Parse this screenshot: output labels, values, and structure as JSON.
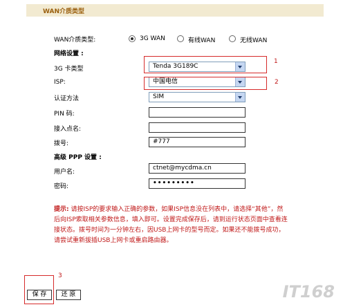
{
  "header": {
    "title": "WAN介质类型"
  },
  "wan_type": {
    "label": "WAN介质类型:",
    "options": [
      {
        "label": "3G WAN",
        "selected": true
      },
      {
        "label": "有线WAN",
        "selected": false
      },
      {
        "label": "无线WAN",
        "selected": false
      }
    ]
  },
  "network_settings": {
    "heading": "网络设置 :",
    "card_type_label": "3G 卡类型",
    "card_type_value": "Tenda 3G189C",
    "isp_label": "ISP:",
    "isp_value": "中国电信",
    "auth_label": "认证方法",
    "auth_value": "SIM",
    "pin_label": "PIN 码:",
    "pin_value": "",
    "apn_label": "接入点名:",
    "apn_value": "",
    "dial_label": "拨号:",
    "dial_value": "#777"
  },
  "ppp_settings": {
    "heading": "高级 PPP 设置 :",
    "username_label": "用户名:",
    "username_value": "ctnet@mycdma.cn",
    "password_label": "密码:",
    "password_value": "•••••••••"
  },
  "annotations": {
    "n1": "1",
    "n2": "2",
    "n3": "3"
  },
  "note": {
    "heading": "提示:",
    "body": "请按ISP的要求输入正确的参数，如果ISP信息没在列表中，请选择“其他”，然后向ISP索取相关参数信息，填入即可。设置完成保存后，请到运行状态页面中查看连接状态。拨号时间为一分钟左右，因USB上网卡的型号而定。如果还不能拨号成功，请尝试重新拔插USB上网卡或重启路由器。"
  },
  "buttons": {
    "save": "保 存",
    "reset": "还 原"
  },
  "watermark": "IT168"
}
